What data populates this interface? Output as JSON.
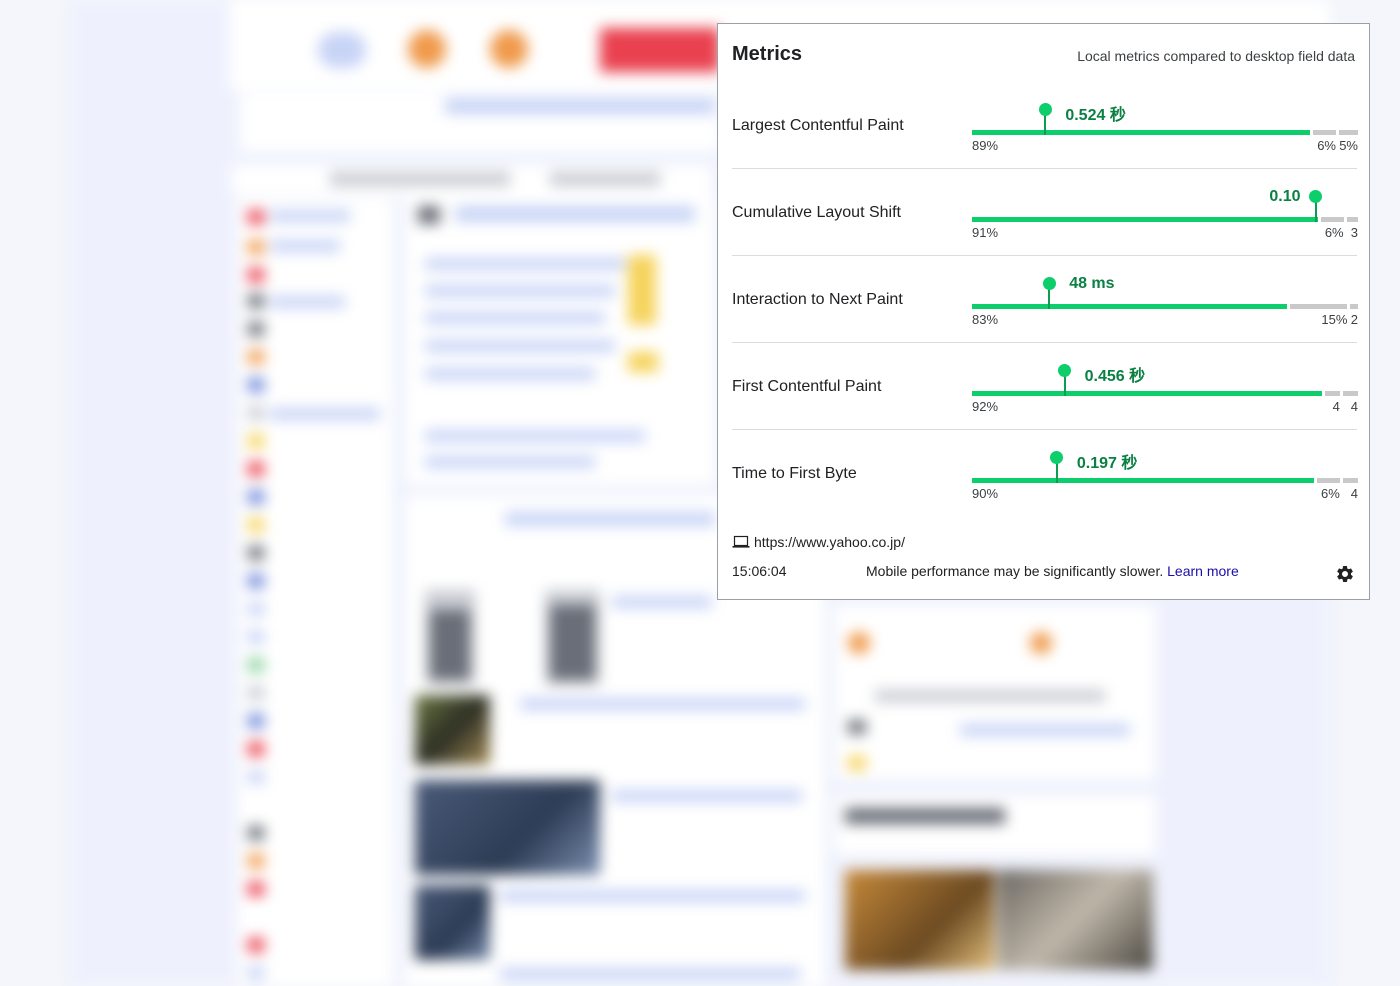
{
  "panel": {
    "title": "Metrics",
    "subtitle": "Local metrics compared to desktop field data"
  },
  "metrics": [
    {
      "name": "Largest Contentful Paint",
      "value": "0.524 秒",
      "good_pct": "89%",
      "ni_pct": "6%",
      "poor_pct": "5%",
      "good_share": 89,
      "ni_share": 6,
      "poor_share": 5,
      "marker_fraction": 0.19,
      "value_side": "right"
    },
    {
      "name": "Cumulative Layout Shift",
      "value": "0.10",
      "good_pct": "91%",
      "ni_pct": "6%",
      "poor_pct": "3",
      "good_share": 91,
      "ni_share": 6,
      "poor_share": 3,
      "marker_fraction": 0.89,
      "value_side": "left"
    },
    {
      "name": "Interaction to Next Paint",
      "value": "48 ms",
      "good_pct": "83%",
      "ni_pct": "15%",
      "poor_pct": "2",
      "good_share": 83,
      "ni_share": 15,
      "poor_share": 2,
      "marker_fraction": 0.2,
      "value_side": "right"
    },
    {
      "name": "First Contentful Paint",
      "value": "0.456 秒",
      "good_pct": "92%",
      "ni_pct": "4",
      "poor_pct": "4",
      "good_share": 92,
      "ni_share": 4,
      "poor_share": 4,
      "marker_fraction": 0.24,
      "value_side": "right"
    },
    {
      "name": "Time to First Byte",
      "value": "0.197 秒",
      "good_pct": "90%",
      "ni_pct": "6%",
      "poor_pct": "4",
      "good_share": 90,
      "ni_share": 6,
      "poor_share": 4,
      "marker_fraction": 0.22,
      "value_side": "right"
    }
  ],
  "footer": {
    "url": "https://www.yahoo.co.jp/",
    "time": "15:06:04",
    "note": "Mobile performance may be significantly slower.",
    "learn_more": "Learn more"
  },
  "colors": {
    "good": "#0cce6b",
    "value_text": "#0b8043",
    "neutral_bar": "#c9c9c9",
    "link": "#1a0dab"
  },
  "icons": [
    "laptop-icon",
    "gear-icon"
  ]
}
